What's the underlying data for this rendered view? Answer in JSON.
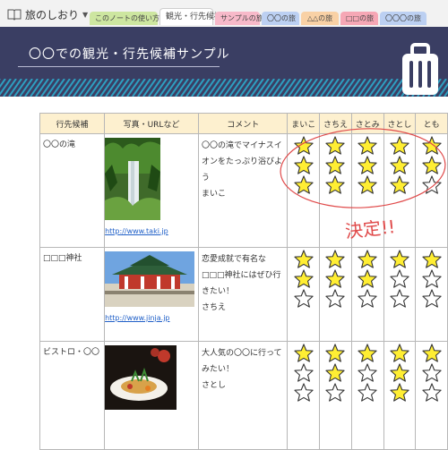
{
  "notebook": {
    "title": "旅のしおり"
  },
  "tabs": [
    {
      "label": "このノートの使い方",
      "color": "#cde6a0"
    },
    {
      "label": "観光・行先候補",
      "color": "#ffffff",
      "active": true
    },
    {
      "label": "サンプルの旅",
      "color": "#f7b9c9"
    },
    {
      "label": "〇〇の旅",
      "color": "#bcd0f2"
    },
    {
      "label": "△△の旅",
      "color": "#f9d1a5"
    },
    {
      "label": "□□の旅",
      "color": "#f6a7b5"
    },
    {
      "label": "〇〇〇の旅",
      "color": "#bcd0f2"
    }
  ],
  "banner": {
    "title": "〇〇での観光・行先候補サンプル"
  },
  "table": {
    "headers": [
      "行先候補",
      "写真・URLなど",
      "コメント",
      "まいこ",
      "さちえ",
      "さとみ",
      "さとし",
      "とも"
    ],
    "rows": [
      {
        "place": "〇〇の滝",
        "url": "http://www.taki.jp",
        "photo": "waterfall",
        "comment": "〇〇の滝でマイナスイオンをたっぷり浴びよう\nまいこ",
        "ratings": [
          3,
          3,
          3,
          3,
          2
        ]
      },
      {
        "place": "□□□神社",
        "url": "http://www.jinja.jp",
        "photo": "shrine",
        "comment": "恋愛成就で有名な□□□神社にはぜひ行きたい！\nさちえ",
        "ratings": [
          2,
          2,
          2,
          1,
          1
        ]
      },
      {
        "place": "ビストロ・〇〇",
        "url": "",
        "photo": "dish",
        "comment": "大人気の〇〇に行ってみたい！\nさとし",
        "ratings": [
          1,
          2,
          1,
          3,
          1
        ]
      }
    ]
  },
  "annotation": {
    "text": "決定!!",
    "color": "#e04a4a"
  },
  "colors": {
    "banner": "#3a3e63",
    "header_bg": "#fdf0cf",
    "star_fill": "#ffee33"
  }
}
